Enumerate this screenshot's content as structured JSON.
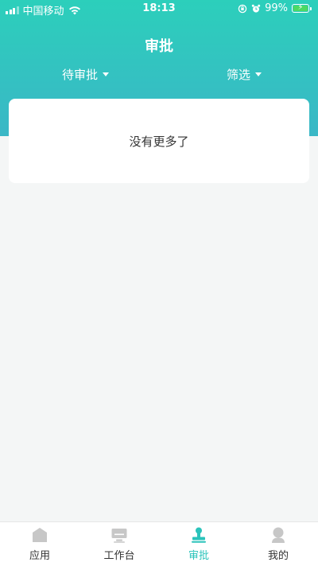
{
  "status_bar": {
    "carrier": "中国移动",
    "time": "18:13",
    "battery": "99%"
  },
  "header": {
    "title": "审批",
    "filters": [
      {
        "label": "待审批"
      },
      {
        "label": "筛选"
      }
    ]
  },
  "content": {
    "empty_message": "没有更多了"
  },
  "tabbar": {
    "active_color": "#2bc3bb",
    "inactive_color": "#c7c7c7",
    "items": [
      {
        "label": "应用",
        "icon": "home-icon"
      },
      {
        "label": "工作台",
        "icon": "monitor-icon"
      },
      {
        "label": "审批",
        "icon": "stamp-icon",
        "active": true
      },
      {
        "label": "我的",
        "icon": "user-icon"
      }
    ]
  }
}
